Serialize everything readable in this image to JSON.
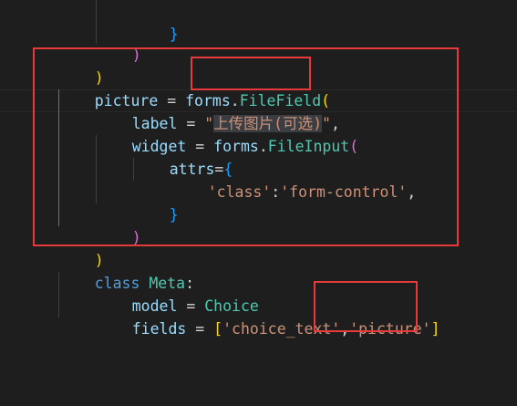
{
  "code": {
    "l1_brace": "}",
    "l2_paren": ")",
    "l3_paren": ")",
    "l4_var": "picture",
    "l4_eq": " = ",
    "l4_forms": "forms",
    "l4_dot": ".",
    "l4_fn": "FileField",
    "l4_open": "(",
    "l5_var": "label",
    "l5_eq": " = ",
    "l5_q1": "\"",
    "l5_str": "上传图片(可选)",
    "l5_q2": "\"",
    "l5_comma": ",",
    "l6_var": "widget",
    "l6_eq": " = ",
    "l6_forms": "forms",
    "l6_dot": ".",
    "l6_fn": "FileInput",
    "l6_open": "(",
    "l7_var": "attrs",
    "l7_eq": "=",
    "l7_brace": "{",
    "l8_key": "'class'",
    "l8_colon": ":",
    "l8_val": "'form-control'",
    "l8_comma": ",",
    "l9_brace": "}",
    "l10_paren": ")",
    "l11_paren": ")",
    "l12_kw": "class",
    "l12_sp": " ",
    "l12_cls": "Meta",
    "l12_colon": ":",
    "l13_var": "model",
    "l13_eq": " = ",
    "l13_val": "Choice",
    "l14_var": "fields",
    "l14_eq": " = ",
    "l14_open": "[",
    "l14_s1": "'choice_text'",
    "l14_comma": ",",
    "l14_s2": "'picture'",
    "l14_close": "]"
  },
  "colors": {
    "background": "#1e1e1e",
    "annotation_box": "#e83a3a",
    "variable": "#9cdcfe",
    "string": "#ce9178",
    "class": "#4ec9b0",
    "keyword": "#569cd6",
    "function": "#dcdcaa",
    "bracket_level1": "#ffd700",
    "bracket_level2": "#da70d6",
    "bracket_level3": "#179fff"
  }
}
